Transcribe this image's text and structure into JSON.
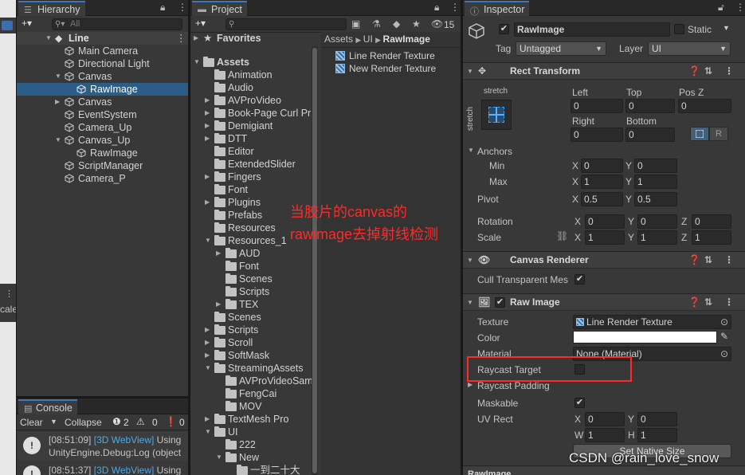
{
  "hierarchy": {
    "tab": "Hierarchy",
    "add": "+▾",
    "search_placeholder": "All",
    "root": "Line",
    "items": [
      {
        "label": "Main Camera"
      },
      {
        "label": "Directional Light"
      },
      {
        "label": "Canvas"
      },
      {
        "label": "RawImage"
      },
      {
        "label": "Canvas"
      },
      {
        "label": "EventSystem"
      },
      {
        "label": "Camera_Up"
      },
      {
        "label": "Canvas_Up"
      },
      {
        "label": "RawImage"
      },
      {
        "label": "ScriptManager"
      },
      {
        "label": "Camera_P"
      }
    ]
  },
  "left_edge": {
    "label": "cale"
  },
  "console": {
    "tab": "Console",
    "clear": "Clear",
    "collapse": "Collapse",
    "count_warn": "2",
    "count_err": "0",
    "count_info": "0",
    "log1_time": "[08:51:09]",
    "log1_tag": "[3D WebView]",
    "log1_rest": " Using",
    "log1_line2": "UnityEngine.Debug:Log (object",
    "log2_time": "[08:51:37]",
    "log2_tag": "[3D WebView]",
    "log2_rest": " Using"
  },
  "project": {
    "tab": "Project",
    "add": "+▾",
    "hidden_count": "15",
    "favorites": "Favorites",
    "assets": "Assets",
    "folders": [
      "Animation",
      "Audio",
      "AVProVideo",
      "Book-Page Curl Pr",
      "Demigiant",
      "DTT",
      "Editor",
      "ExtendedSlider",
      "Fingers",
      "Font",
      "Plugins",
      "Prefabs",
      "Resources",
      "Resources_1",
      "AUD",
      "Font",
      "Scenes",
      "Scripts",
      "TEX",
      "Scenes",
      "Scripts",
      "Scroll",
      "SoftMask",
      "StreamingAssets",
      "AVProVideoSam",
      "FengCai",
      "MOV",
      "TextMesh Pro",
      "UI",
      "222",
      "New",
      "一到二十大"
    ],
    "breadcrumb": [
      "Assets",
      "UI",
      "RawImage"
    ],
    "files": [
      "Line Render Texture",
      "New Render Texture"
    ]
  },
  "annotation": {
    "line1": "当胶片的canvas的",
    "line2": "rawimage去掉射线检测",
    "color": "#ff2a2a"
  },
  "inspector": {
    "tab": "Inspector",
    "object_name": "RawImage",
    "static_label": "Static",
    "tag_label": "Tag",
    "tag_value": "Untagged",
    "layer_label": "Layer",
    "layer_value": "UI",
    "rect": {
      "title": "Rect Transform",
      "anchor_h": "stretch",
      "anchor_v": "stretch",
      "left_label": "Left",
      "left": "0",
      "top_label": "Top",
      "top": "0",
      "posz_label": "Pos Z",
      "posz": "0",
      "right_label": "Right",
      "right": "0",
      "bottom_label": "Bottom",
      "bottom": "0",
      "r_btn": "R",
      "anchors_label": "Anchors",
      "min_label": "Min",
      "min_x": "0",
      "min_y": "0",
      "max_label": "Max",
      "max_x": "1",
      "max_y": "1",
      "pivot_label": "Pivot",
      "pivot_x": "0.5",
      "pivot_y": "0.5",
      "rotation_label": "Rotation",
      "rot_x": "0",
      "rot_y": "0",
      "rot_z": "0",
      "scale_label": "Scale",
      "scale_x": "1",
      "scale_y": "1",
      "scale_z": "1",
      "x": "X",
      "y": "Y",
      "z": "Z"
    },
    "canvas_renderer": {
      "title": "Canvas Renderer",
      "cull_label": "Cull Transparent Mes"
    },
    "raw_image": {
      "title": "Raw Image",
      "texture_label": "Texture",
      "texture_value": "Line Render Texture",
      "color_label": "Color",
      "material_label": "Material",
      "material_value": "None (Material)",
      "raycast_target_label": "Raycast Target",
      "raycast_padding_label": "Raycast Padding",
      "maskable_label": "Maskable",
      "uvrect_label": "UV Rect",
      "uv_x": "0",
      "uv_y": "0",
      "uv_w": "1",
      "uv_h": "1",
      "x": "X",
      "y": "Y",
      "w": "W",
      "h": "H",
      "native_size_btn": "Set Native Size"
    },
    "next_component": "RawImage"
  },
  "watermark": "CSDN @rain_love_snow"
}
